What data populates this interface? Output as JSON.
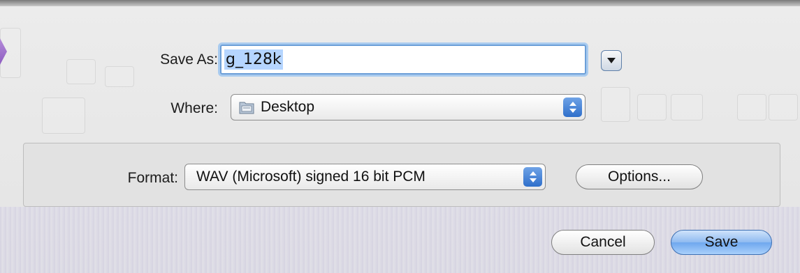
{
  "save_as": {
    "label": "Save As:",
    "value": "g_128k"
  },
  "where": {
    "label": "Where:",
    "selected": "Desktop"
  },
  "format": {
    "label": "Format:",
    "selected": "WAV (Microsoft) signed 16 bit PCM"
  },
  "buttons": {
    "options": "Options...",
    "cancel": "Cancel",
    "save": "Save"
  },
  "colors": {
    "accent": "#3c6fb3",
    "selection": "#b5d5ff",
    "focus_ring": "#a9cbef"
  }
}
